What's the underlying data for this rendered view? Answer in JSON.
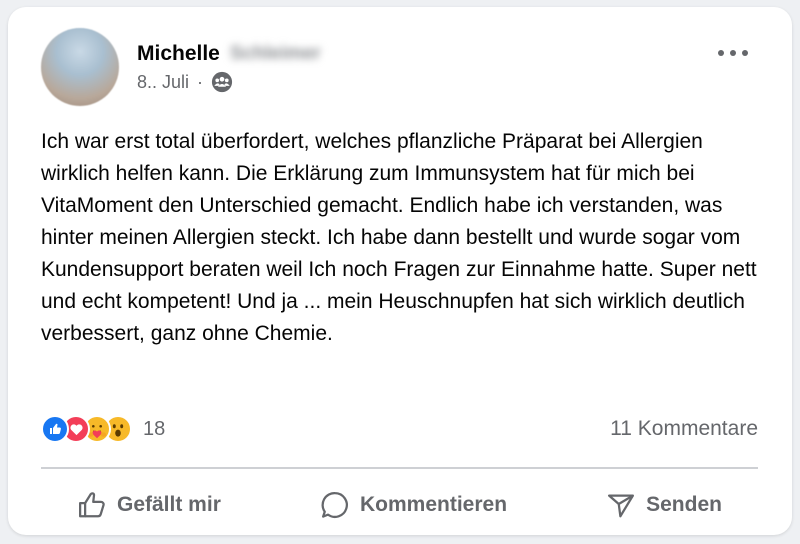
{
  "post": {
    "author_first": "Michelle",
    "author_last_blurred": "Schleimer",
    "date": "8.. Juli",
    "separator": "·",
    "audience_icon": "group-icon",
    "text": "Ich war erst total überfordert, welches pflanzliche Präparat bei Allergien wirklich helfen kann. Die Erklärung zum Immunsystem hat für mich bei VitaMoment den Unterschied gemacht. Endlich habe ich verstanden, was hinter meinen Allergien steckt. Ich habe dann bestellt und wurde sogar vom Kundensupport beraten weil Ich noch Fragen zur Einnahme hatte. Super nett und echt kompetent! Und ja ... mein Heuschnupfen hat sich wirklich deutlich verbessert, ganz ohne Chemie."
  },
  "reactions": {
    "types": [
      "like",
      "love",
      "care",
      "wow"
    ],
    "count": "18"
  },
  "comments": {
    "count_label": "11 Kommentare"
  },
  "actions": {
    "like_label": "Gefällt mir",
    "comment_label": "Kommentieren",
    "send_label": "Senden"
  },
  "colors": {
    "like": "#1877f2",
    "love": "#f33e58",
    "care": "#f7b928",
    "wow": "#f7b928",
    "secondary_text": "#65676b"
  }
}
